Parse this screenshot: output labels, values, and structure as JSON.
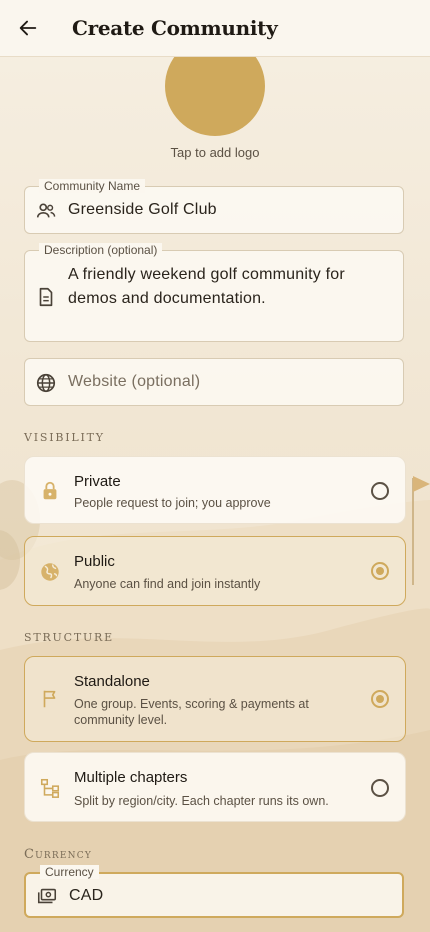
{
  "appbar": {
    "title": "Create Community",
    "back_icon": "arrow-back-icon"
  },
  "logo": {
    "caption": "Tap to add logo"
  },
  "fields": {
    "name": {
      "label": "Community Name",
      "value": "Greenside Golf Club",
      "icon": "people-icon"
    },
    "description": {
      "label": "Description (optional)",
      "value": "A friendly weekend golf community for demos and documentation.",
      "icon": "document-icon"
    },
    "website": {
      "placeholder": "Website (optional)",
      "icon": "globe-icon"
    }
  },
  "visibility": {
    "heading": "VISIBILITY",
    "options": [
      {
        "title": "Private",
        "desc": "People request to join; you approve",
        "icon": "lock-icon",
        "selected": false
      },
      {
        "title": "Public",
        "desc": "Anyone can find and join instantly",
        "icon": "globe-icon",
        "selected": true
      }
    ]
  },
  "structure": {
    "heading": "STRUCTURE",
    "options": [
      {
        "title": "Standalone",
        "desc": "One group. Events, scoring & payments at community level.",
        "icon": "flag-icon",
        "selected": true
      },
      {
        "title": "Multiple chapters",
        "desc": "Split by region/city. Each chapter runs its own.",
        "icon": "hierarchy-icon",
        "selected": false
      }
    ]
  },
  "currency": {
    "heading": "Currency",
    "label": "Currency",
    "value": "CAD",
    "icon": "cash-icon"
  },
  "colors": {
    "accent": "#cfa95c",
    "background": "#f3eadb",
    "surface": "#fdfaf4"
  }
}
